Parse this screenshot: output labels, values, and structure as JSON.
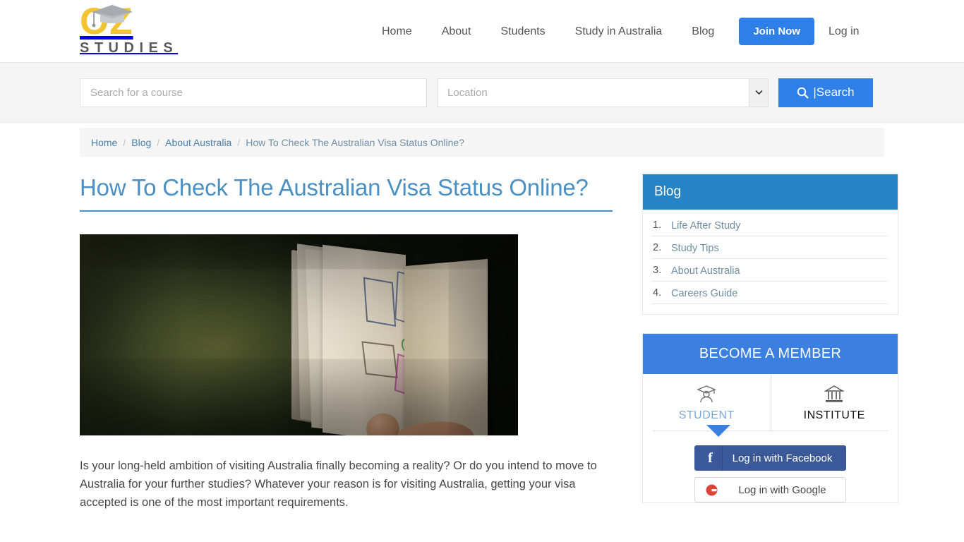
{
  "site": {
    "logo_primary": "OZ",
    "logo_secondary": "STUDIES",
    "accent_blue": "#2f7fe8",
    "panel_blue": "#2484c6",
    "member_blue": "#3b7fe0",
    "logo_gold": "#f2c430"
  },
  "nav": {
    "items": [
      {
        "label": "Home"
      },
      {
        "label": "About"
      },
      {
        "label": "Students"
      },
      {
        "label": "Study in Australia"
      },
      {
        "label": "Blog"
      }
    ],
    "join_label": "Join Now",
    "login_label": "Log in"
  },
  "search": {
    "course_placeholder": "Search for a course",
    "course_value": "",
    "location_placeholder": "Location",
    "location_value": "",
    "location_caret_icon": "chevron-down-icon",
    "button_icon": "search-icon",
    "button_label": "|Search"
  },
  "breadcrumb": {
    "items": [
      {
        "label": "Home"
      },
      {
        "label": "Blog"
      },
      {
        "label": "About Australia"
      },
      {
        "label": "How To Check The Australian Visa Status Online?"
      }
    ],
    "separator": "/"
  },
  "article": {
    "title": "How To Check The Australian Visa Status Online?",
    "hero_alt": "hand holding an open passport with visa stamps",
    "paragraph": "Is your long-held ambition of visiting Australia finally becoming a reality? Or do you intend to move to Australia for your further studies? Whatever your reason is for visiting Australia, getting your visa accepted is one of the most important requirements."
  },
  "sidebar": {
    "blog_panel": {
      "heading": "Blog",
      "items": [
        {
          "label": "Life After Study"
        },
        {
          "label": "Study Tips"
        },
        {
          "label": "About Australia"
        },
        {
          "label": "Careers Guide"
        }
      ]
    },
    "member_panel": {
      "heading": "BECOME A MEMBER",
      "tabs": [
        {
          "label": "STUDENT",
          "icon": "graduate-icon",
          "active": true
        },
        {
          "label": "INSTITUTE",
          "icon": "institution-icon",
          "active": false
        }
      ],
      "facebook_label": "Log in with Facebook",
      "facebook_icon": "facebook-icon",
      "google_label": "Log in with Google",
      "google_icon": "google-icon"
    }
  }
}
